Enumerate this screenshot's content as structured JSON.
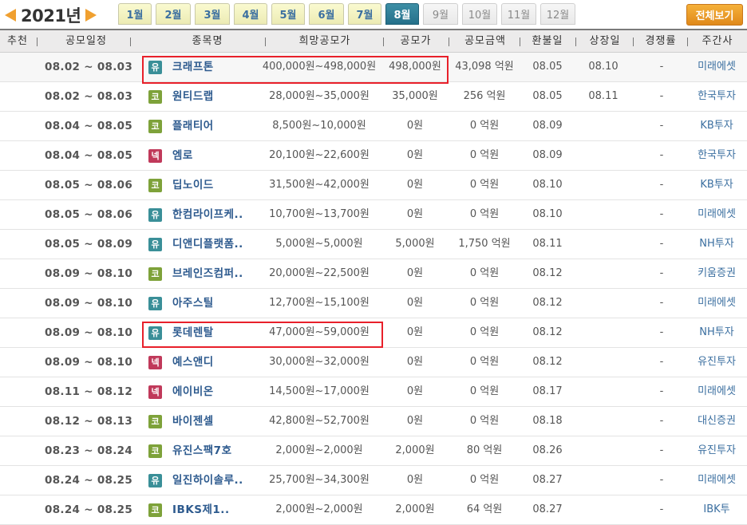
{
  "year_nav": {
    "year": "2021년"
  },
  "months": [
    {
      "label": "1월",
      "state": "normal"
    },
    {
      "label": "2월",
      "state": "normal"
    },
    {
      "label": "3월",
      "state": "normal"
    },
    {
      "label": "4월",
      "state": "normal"
    },
    {
      "label": "5월",
      "state": "normal"
    },
    {
      "label": "6월",
      "state": "normal"
    },
    {
      "label": "7월",
      "state": "normal"
    },
    {
      "label": "8월",
      "state": "active"
    },
    {
      "label": "9월",
      "state": "disabled"
    },
    {
      "label": "10월",
      "state": "disabled"
    },
    {
      "label": "11월",
      "state": "disabled"
    },
    {
      "label": "12월",
      "state": "disabled"
    }
  ],
  "view_all_label": "전체보기",
  "headers": {
    "recommend": "추천",
    "period": "공모일정",
    "name": "종목명",
    "hope_price": "희망공모가",
    "price": "공모가",
    "amount": "공모금액",
    "refund": "환불일",
    "listing": "상장일",
    "competition": "경쟁률",
    "manager": "주간사"
  },
  "badge_labels": {
    "yu": "유",
    "ko": "코",
    "ne": "넥"
  },
  "colors": {
    "badge_yu": "#3a8f98",
    "badge_ko": "#7ea23a",
    "badge_ne": "#c0395a",
    "highlight": "#e8202a",
    "active_month": "#2f7f97",
    "view_all": "#e8951f"
  },
  "rows": [
    {
      "period": "08.02 ~ 08.03",
      "market": "yu",
      "name": "크래프톤",
      "hope": "400,000원~498,000원",
      "price": "498,000원",
      "amount": "43,098 억원",
      "refund": "08.05",
      "listing": "08.10",
      "competition": "-",
      "manager": "미래에셋"
    },
    {
      "period": "08.02 ~ 08.03",
      "market": "ko",
      "name": "원티드랩",
      "hope": "28,000원~35,000원",
      "price": "35,000원",
      "amount": "256 억원",
      "refund": "08.05",
      "listing": "08.11",
      "competition": "-",
      "manager": "한국투자"
    },
    {
      "period": "08.04 ~ 08.05",
      "market": "ko",
      "name": "플래티어",
      "hope": "8,500원~10,000원",
      "price": "0원",
      "amount": "0 억원",
      "refund": "08.09",
      "listing": "",
      "competition": "-",
      "manager": "KB투자"
    },
    {
      "period": "08.04 ~ 08.05",
      "market": "ne",
      "name": "엠로",
      "hope": "20,100원~22,600원",
      "price": "0원",
      "amount": "0 억원",
      "refund": "08.09",
      "listing": "",
      "competition": "-",
      "manager": "한국투자"
    },
    {
      "period": "08.05 ~ 08.06",
      "market": "ko",
      "name": "딥노이드",
      "hope": "31,500원~42,000원",
      "price": "0원",
      "amount": "0 억원",
      "refund": "08.10",
      "listing": "",
      "competition": "-",
      "manager": "KB투자"
    },
    {
      "period": "08.05 ~ 08.06",
      "market": "yu",
      "name": "한컴라이프케..",
      "hope": "10,700원~13,700원",
      "price": "0원",
      "amount": "0 억원",
      "refund": "08.10",
      "listing": "",
      "competition": "-",
      "manager": "미래에셋"
    },
    {
      "period": "08.05 ~ 08.09",
      "market": "yu",
      "name": "디앤디플랫폼..",
      "hope": "5,000원~5,000원",
      "price": "5,000원",
      "amount": "1,750 억원",
      "refund": "08.11",
      "listing": "",
      "competition": "-",
      "manager": "NH투자"
    },
    {
      "period": "08.09 ~ 08.10",
      "market": "ko",
      "name": "브레인즈컴퍼..",
      "hope": "20,000원~22,500원",
      "price": "0원",
      "amount": "0 억원",
      "refund": "08.12",
      "listing": "",
      "competition": "-",
      "manager": "키움증권"
    },
    {
      "period": "08.09 ~ 08.10",
      "market": "yu",
      "name": "아주스틸",
      "hope": "12,700원~15,100원",
      "price": "0원",
      "amount": "0 억원",
      "refund": "08.12",
      "listing": "",
      "competition": "-",
      "manager": "미래에셋"
    },
    {
      "period": "08.09 ~ 08.10",
      "market": "yu",
      "name": "롯데렌탈",
      "hope": "47,000원~59,000원",
      "price": "0원",
      "amount": "0 억원",
      "refund": "08.12",
      "listing": "",
      "competition": "-",
      "manager": "NH투자"
    },
    {
      "period": "08.09 ~ 08.10",
      "market": "ne",
      "name": "예스앤디",
      "hope": "30,000원~32,000원",
      "price": "0원",
      "amount": "0 억원",
      "refund": "08.12",
      "listing": "",
      "competition": "-",
      "manager": "유진투자"
    },
    {
      "period": "08.11 ~ 08.12",
      "market": "ne",
      "name": "에이비온",
      "hope": "14,500원~17,000원",
      "price": "0원",
      "amount": "0 억원",
      "refund": "08.17",
      "listing": "",
      "competition": "-",
      "manager": "미래에셋"
    },
    {
      "period": "08.12 ~ 08.13",
      "market": "ko",
      "name": "바이젠셀",
      "hope": "42,800원~52,700원",
      "price": "0원",
      "amount": "0 억원",
      "refund": "08.18",
      "listing": "",
      "competition": "-",
      "manager": "대신증권"
    },
    {
      "period": "08.23 ~ 08.24",
      "market": "ko",
      "name": "유진스팩7호",
      "hope": "2,000원~2,000원",
      "price": "2,000원",
      "amount": "80 억원",
      "refund": "08.26",
      "listing": "",
      "competition": "-",
      "manager": "유진투자"
    },
    {
      "period": "08.24 ~ 08.25",
      "market": "yu",
      "name": "일진하이솔루..",
      "hope": "25,700원~34,300원",
      "price": "0원",
      "amount": "0 억원",
      "refund": "08.27",
      "listing": "",
      "competition": "-",
      "manager": "미래에셋"
    },
    {
      "period": "08.24 ~ 08.25",
      "market": "ko",
      "name": "IBKS제1..",
      "hope": "2,000원~2,000원",
      "price": "2,000원",
      "amount": "64 억원",
      "refund": "08.27",
      "listing": "",
      "competition": "-",
      "manager": "IBK투"
    }
  ]
}
